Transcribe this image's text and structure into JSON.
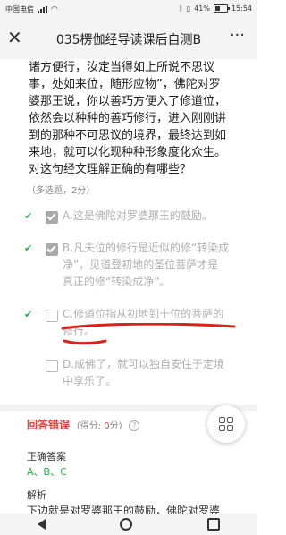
{
  "status_bar": {
    "carrier": "中国电信",
    "battery": "41%",
    "time": "15:54"
  },
  "header": {
    "title": "035楞伽经导读课后自测B",
    "close_icon": "close-icon",
    "more_icon": "more-icon"
  },
  "question": {
    "lines": [
      "诸方便行，汝定当得如上所说不思议",
      "事，处如来位，随形应物”，佛陀对罗",
      "婆那王说，你以善巧方便入了修道位，",
      "依然会以种种的善巧修行，进入刚刚讲",
      "到的那种不可思议的境界，最终达到如",
      "来地，就可以化现种种形象度化众生。",
      "对这句经文理解正确的有哪些？"
    ],
    "type": "（多选题，2分）"
  },
  "options": [
    {
      "lines": [
        "A.这是佛陀对罗婆那王的鼓励。"
      ],
      "checked": true,
      "correct_mark": true
    },
    {
      "lines": [
        "B.凡夫位的修行是近似的修“转染成",
        "净”，见道登初地的圣位菩萨才是",
        "真正的修“转染成净”。"
      ],
      "checked": true,
      "correct_mark": true
    },
    {
      "lines": [
        "C.修道位指从初地到十位的菩萨的",
        "修行。"
      ],
      "checked": false,
      "correct_mark": true
    },
    {
      "lines": [
        "D.成佛了，就可以独自安住于定境",
        "中享乐了。"
      ],
      "checked": false,
      "correct_mark": false
    }
  ],
  "result": {
    "status": "回答错误",
    "score_prefix": "(得分: ",
    "score": "0",
    "score_suffix": "分)"
  },
  "answer": {
    "label": "正确答案",
    "value": "A、B、C"
  },
  "analysis": {
    "label": "解析",
    "text": "下边就是对罗婆那王的鼓励，佛陀对罗婆"
  },
  "colors": {
    "correct": "#2eae4c",
    "wrong": "#e0443e",
    "annotation": "#d9231a"
  }
}
